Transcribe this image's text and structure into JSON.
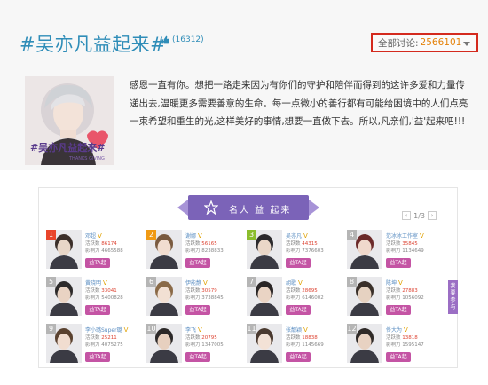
{
  "header": {
    "title": "#吴亦凡益起来#",
    "likes": "(16312)",
    "total_label": "全部讨论:",
    "total_value": "2566101"
  },
  "description": "感恩一直有你。想把一路走来因为有你们的守护和陪伴而得到的这许多爱和力量传递出去,温暖更多需要善意的生命。每一点微小的善行都有可能给困境中的人们点亮一束希望和重生的光,这样美好的事情,想要一直做下去。所以,凡亲们,'益'起来吧!!!",
  "avatar_caption": {
    "main": "#吴亦凡益起来#",
    "sub": "THANKS GIVING"
  },
  "board": {
    "banner_text": "名人 益 起来",
    "pager": "1/3",
    "side_tab": "我要参与",
    "button_label": "益TA起",
    "l1_label": "活跃数",
    "l2_label": "影响力",
    "people": [
      {
        "rank": "1",
        "name": "邓超",
        "act": "86174",
        "inf": "4665588",
        "rank_color": "#e9452b"
      },
      {
        "rank": "2",
        "name": "谢娜",
        "act": "56165",
        "inf": "8238833",
        "rank_color": "#f09a14"
      },
      {
        "rank": "3",
        "name": "吴亦凡",
        "act": "44315",
        "inf": "7376603",
        "rank_color": "#8bbd2d"
      },
      {
        "rank": "4",
        "name": "范冰冰工作室",
        "act": "35845",
        "inf": "1134649",
        "rank_color": "#b5b5b5"
      },
      {
        "rank": "5",
        "name": "黄晓明",
        "act": "33041",
        "inf": "5400828",
        "rank_color": "#b5b5b5"
      },
      {
        "rank": "6",
        "name": "伊能静",
        "act": "30579",
        "inf": "3738845",
        "rank_color": "#b5b5b5"
      },
      {
        "rank": "7",
        "name": "胡歌",
        "act": "28695",
        "inf": "6146002",
        "rank_color": "#b5b5b5"
      },
      {
        "rank": "8",
        "name": "陈坤",
        "act": "27883",
        "inf": "1056092",
        "rank_color": "#b5b5b5"
      },
      {
        "rank": "9",
        "name": "李小璐Super璐",
        "act": "25211",
        "inf": "4075275",
        "rank_color": "#b5b5b5"
      },
      {
        "rank": "10",
        "name": "李飞",
        "act": "20795",
        "inf": "1347005",
        "rank_color": "#b5b5b5"
      },
      {
        "rank": "11",
        "name": "张靓颖",
        "act": "18838",
        "inf": "1145669",
        "rank_color": "#b5b5b5"
      },
      {
        "rank": "12",
        "name": "佟大为",
        "act": "13818",
        "inf": "1595147",
        "rank_color": "#b5b5b5"
      }
    ]
  }
}
